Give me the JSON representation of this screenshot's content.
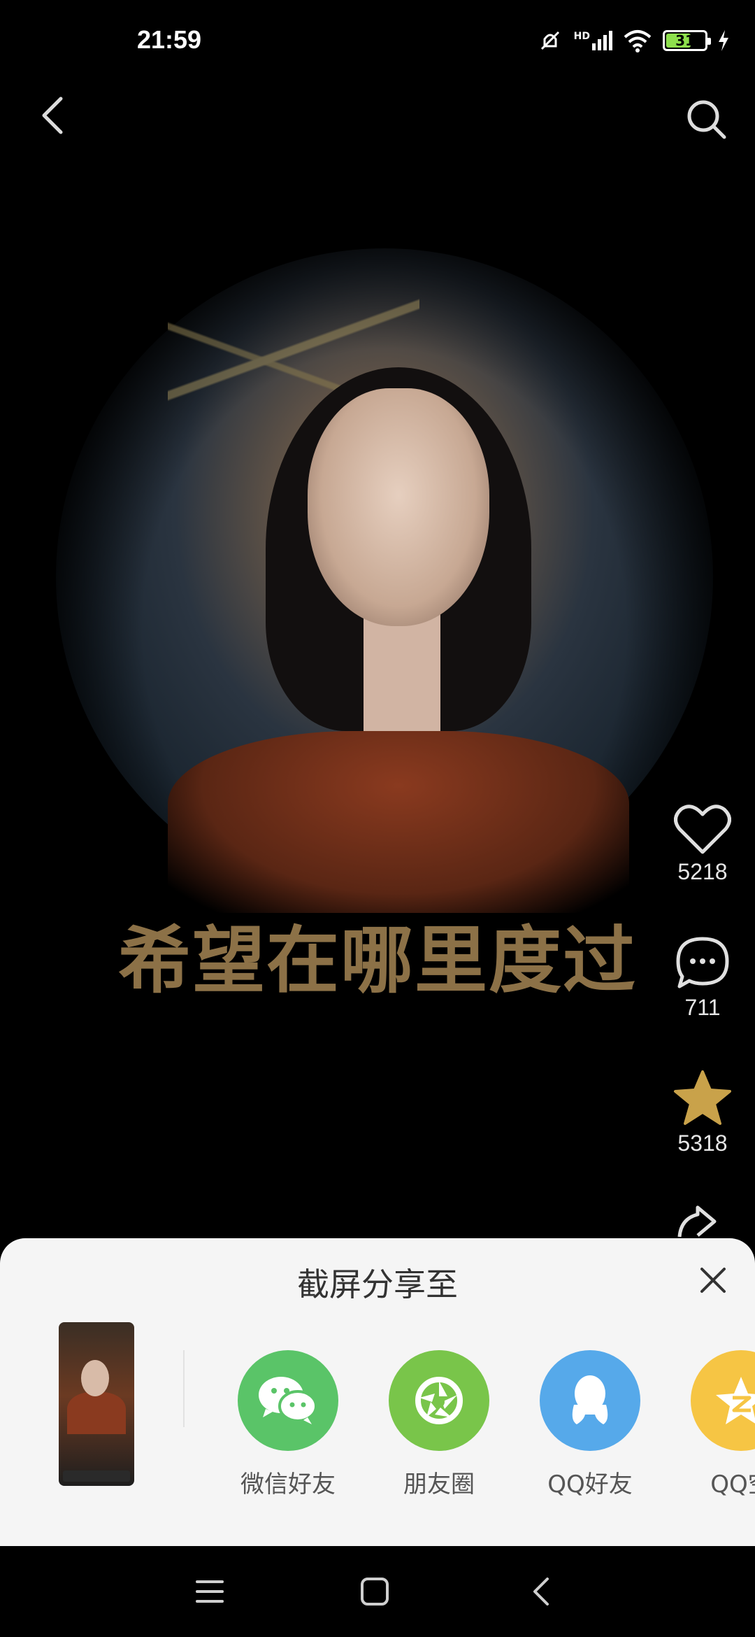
{
  "status_bar": {
    "time": "21:59",
    "network_label": "HD",
    "battery_level": "31",
    "icons": [
      "mute-icon",
      "signal-icon",
      "wifi-icon",
      "battery-icon",
      "charging-icon"
    ]
  },
  "nav": {
    "back_icon": "chevron-left-icon",
    "search_icon": "search-icon"
  },
  "video": {
    "subtitle": "希望在哪里度过"
  },
  "actions": {
    "like_count": "5218",
    "comment_count": "711",
    "favorite_count": "5318"
  },
  "share_sheet": {
    "title": "截屏分享至",
    "items": [
      {
        "label": "微信好友",
        "icon": "wechat-icon",
        "color": "#5ac468"
      },
      {
        "label": "朋友圈",
        "icon": "moments-icon",
        "color": "#79c54a"
      },
      {
        "label": "QQ好友",
        "icon": "qq-icon",
        "color": "#56a9ea"
      },
      {
        "label": "QQ空",
        "icon": "qzone-icon",
        "color": "#f6c544"
      }
    ]
  },
  "colors": {
    "subtitle": "#8c7147",
    "sheet_bg": "#f5f5f5",
    "favorite_star": "#c9a24a"
  }
}
